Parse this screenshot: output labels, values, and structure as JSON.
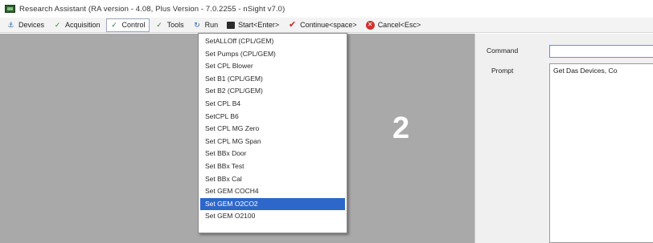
{
  "window": {
    "title": "Research Assistant (RA version - 4.08, Plus Version - 7.0.2255 - nSight v7.0)"
  },
  "toolbar": {
    "items": [
      {
        "label": "Devices",
        "icon": "devices-icon"
      },
      {
        "label": "Acquisition",
        "icon": "tool-icon"
      },
      {
        "label": "Control",
        "icon": "tool-icon"
      },
      {
        "label": "Tools",
        "icon": "tool-icon"
      },
      {
        "label": "Run",
        "icon": "run-icon"
      },
      {
        "label": "Start<Enter>",
        "icon": "start-icon"
      },
      {
        "label": "Continue<space>",
        "icon": "check-icon"
      },
      {
        "label": "Cancel<Esc>",
        "icon": "cancel-icon"
      }
    ],
    "active_index": 2
  },
  "control_menu": {
    "items": [
      "SetALLOff (CPL/GEM)",
      "Set Pumps (CPL/GEM)",
      "Set CPL Blower",
      "Set B1 (CPL/GEM)",
      "Set B2 (CPL/GEM)",
      "Set CPL B4",
      "SetCPL B6",
      "Set CPL MG Zero",
      "Set CPL MG Span",
      "Set BBx Door",
      "Set BBx Test",
      "Set BBx Cal",
      "Set GEM COCH4",
      "Set GEM O2CO2",
      "Set GEM O2100"
    ],
    "selected_index": 13
  },
  "overlay": {
    "step_number": "2"
  },
  "command_panel": {
    "command_label": "Command",
    "command_value": "",
    "prompt_label": "Prompt",
    "prompt_text": "Get Das Devices, Co"
  },
  "colors": {
    "selection": "#2d67c9",
    "panel_gray": "#a9a9a9",
    "input_border": "#6b8cc7"
  }
}
